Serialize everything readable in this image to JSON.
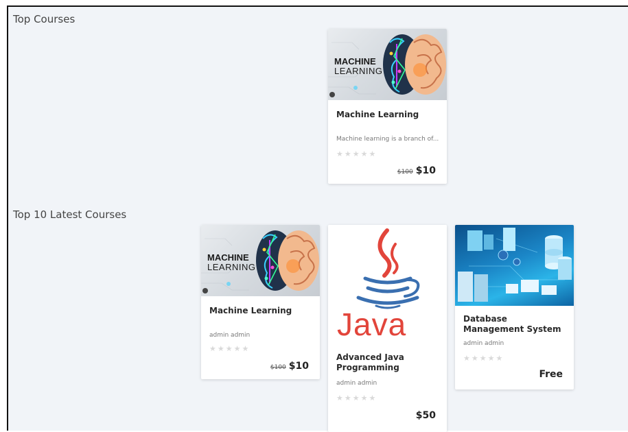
{
  "sections": {
    "top_title": "Top Courses",
    "latest_title": "Top 10 Latest Courses"
  },
  "top_courses": [
    {
      "thumb_text_line1": "MACHINE",
      "thumb_text_line2": "LEARNING",
      "title": "Machine Learning",
      "description": "Machine learning is a branch of...",
      "rating_stars": "★★★★★",
      "old_price": "$100",
      "price": "$10"
    }
  ],
  "latest_courses": [
    {
      "thumb_text_line1": "MACHINE",
      "thumb_text_line2": "LEARNING",
      "title": "Machine Learning",
      "author": "admin admin",
      "rating_stars": "★★★★★",
      "old_price": "$100",
      "price": "$10"
    },
    {
      "thumb_text": "Java",
      "title": "Advanced Java Programming",
      "author": "admin admin",
      "rating_stars": "★★★★★",
      "price": "$50"
    },
    {
      "title": "Database Management System",
      "author": "admin admin",
      "rating_stars": "★★★★★",
      "price": "Free"
    }
  ],
  "colors": {
    "page_bg": "#f1f4f8",
    "java_red": "#e2453b",
    "java_blue": "#3a6fb0",
    "star_empty": "#d9d9d9"
  }
}
